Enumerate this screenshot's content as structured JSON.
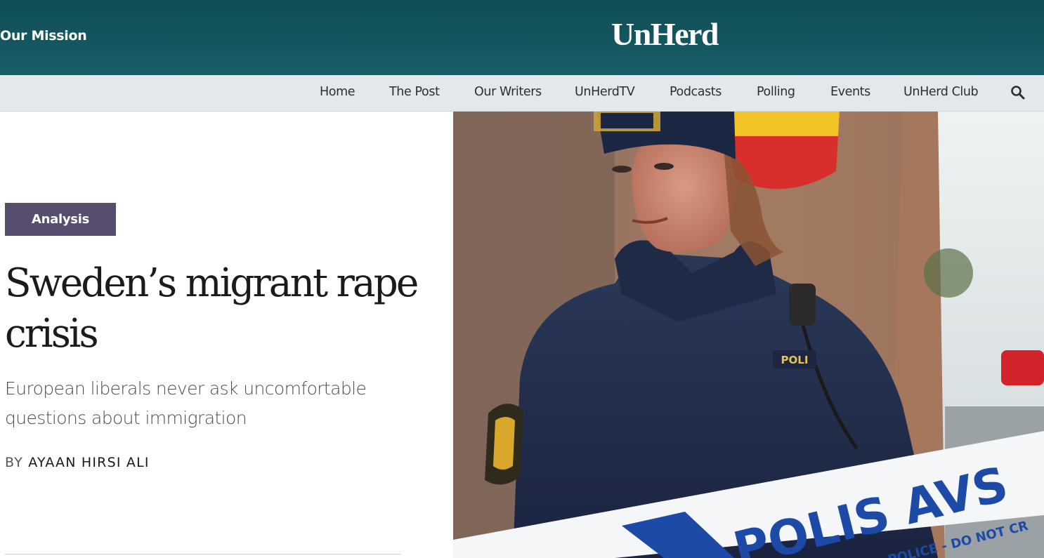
{
  "header": {
    "mission_link": "Our Mission",
    "logo_text": "UnHerd",
    "background_color": "#165962"
  },
  "nav": {
    "items": [
      {
        "label": "Home"
      },
      {
        "label": "The Post"
      },
      {
        "label": "Our Writers"
      },
      {
        "label": "UnHerdTV"
      },
      {
        "label": "Podcasts"
      },
      {
        "label": "Polling"
      },
      {
        "label": "Events"
      },
      {
        "label": "UnHerd Club"
      }
    ],
    "search_icon": "search-icon"
  },
  "article": {
    "tag": "Analysis",
    "tag_color": "#574d6c",
    "headline": "Sweden’s migrant rape crisis",
    "standfirst": "European liberals never ask uncomfortable questions about immigration",
    "byline_prefix": "BY",
    "author": "AYAAN HIRSI ALI"
  },
  "hero_image": {
    "subject": "police-officer-photo",
    "tape_text": "POLIS AVS",
    "tape_subtext": "POLICE - DO NOT CR",
    "badge_text": "POLI"
  }
}
